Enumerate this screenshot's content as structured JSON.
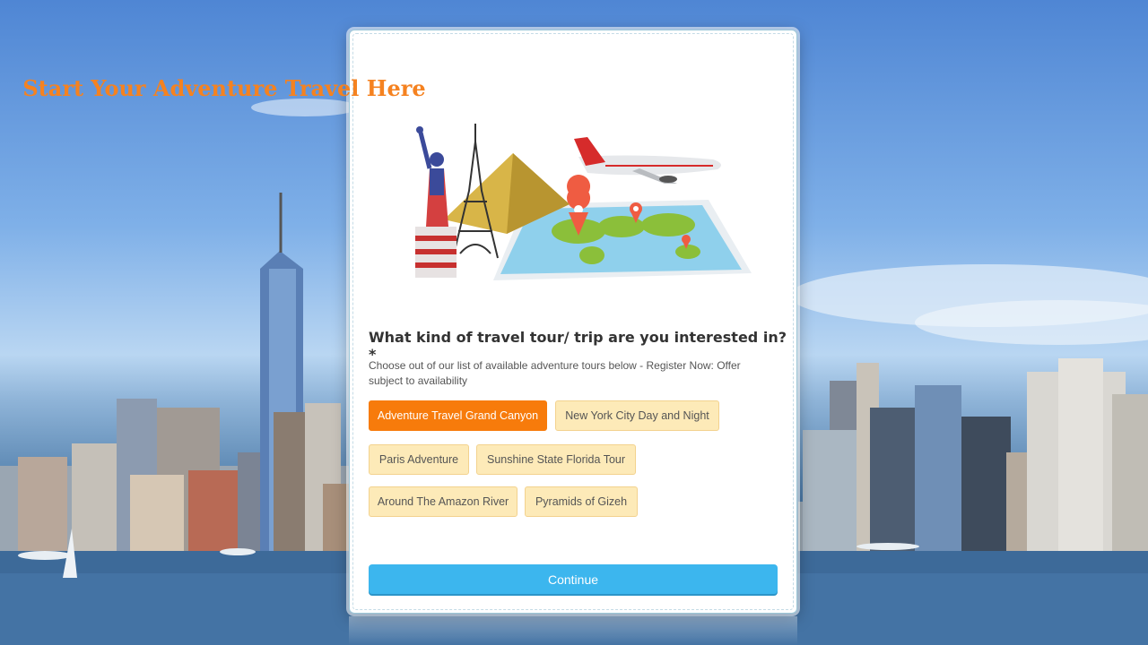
{
  "form": {
    "title": "Start Your Adventure Travel Here",
    "question": "What kind of travel tour/ trip are you interested in? *",
    "description": "Choose out of our list of available adventure tours below - Register Now: Offer subject to availability",
    "options": [
      {
        "label": "Adventure Travel Grand Canyon",
        "selected": true
      },
      {
        "label": "New York City Day and Night",
        "selected": false
      },
      {
        "label": "Paris Adventure",
        "selected": false
      },
      {
        "label": "Sunshine State Florida Tour",
        "selected": false
      },
      {
        "label": "Around The Amazon River",
        "selected": false
      },
      {
        "label": "Pyramids of Gizeh",
        "selected": false
      }
    ],
    "continue_label": "Continue"
  },
  "colors": {
    "accent": "#f58220",
    "selected_option": "#f77b0b",
    "option_bg": "#fdeab8",
    "continue_button": "#3cb6ee"
  },
  "icons": [
    "statue-of-liberty-icon",
    "eiffel-tower-icon",
    "pyramid-icon",
    "airplane-icon",
    "world-map-icon",
    "map-pin-icon"
  ]
}
